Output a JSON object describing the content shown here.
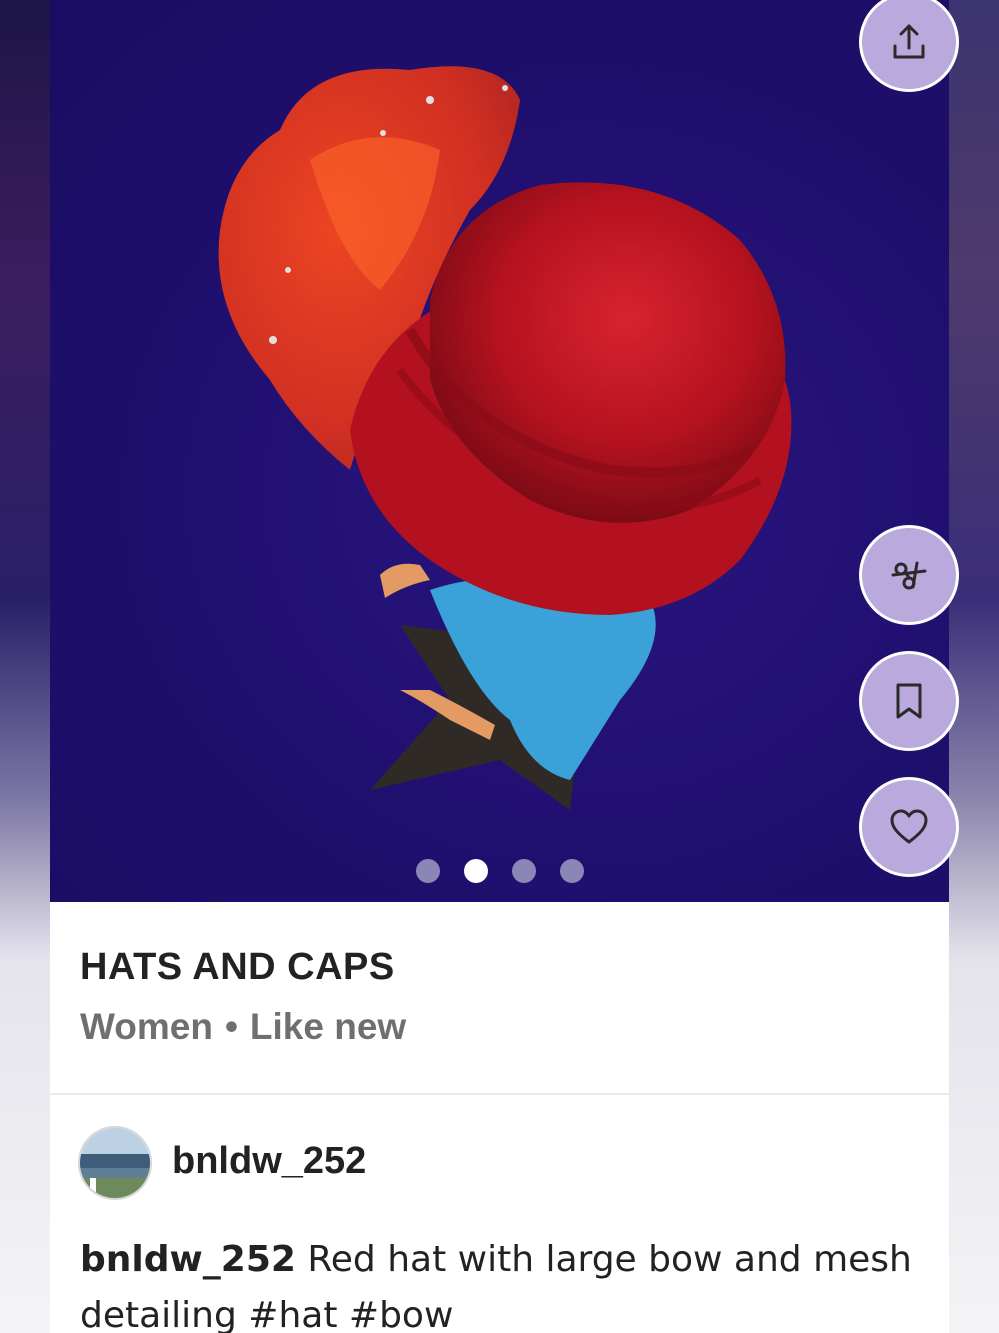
{
  "listing": {
    "title": "HATS AND CAPS",
    "department": "Women",
    "separator": "•",
    "condition": "Like new"
  },
  "carousel": {
    "total_images": 4,
    "active_index": 1
  },
  "actions": {
    "share": "share-icon",
    "offer": "scissors-icon",
    "save": "bookmark-icon",
    "like": "heart-icon"
  },
  "seller": {
    "username": "bnldw_252"
  },
  "description": {
    "username": "bnldw_252",
    "text": " Red hat with large bow and mesh detailing ",
    "hashtags": [
      "#hat",
      "#bow"
    ]
  },
  "colors": {
    "photo_bg": "#1f0f6e",
    "fab_bg": "#b9a9dc",
    "hashtag": "#222222"
  }
}
